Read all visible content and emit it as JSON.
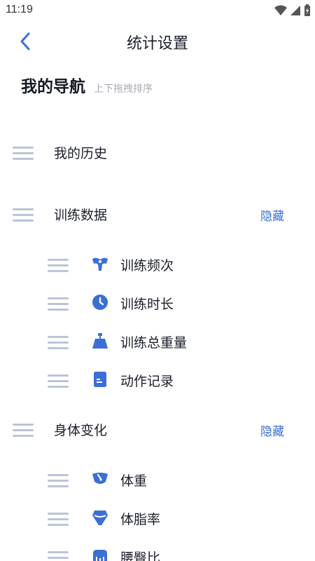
{
  "status_bar": {
    "time": "11:19"
  },
  "header": {
    "title": "统计设置"
  },
  "nav_section": {
    "title": "我的导航",
    "hint": "上下拖拽排序"
  },
  "groups": [
    {
      "label": "我的历史"
    },
    {
      "label": "训练数据",
      "action": "隐藏",
      "items": [
        {
          "label": "训练频次",
          "icon": "muscle-icon"
        },
        {
          "label": "训练时长",
          "icon": "clock-icon"
        },
        {
          "label": "训练总重量",
          "icon": "weight-icon"
        },
        {
          "label": "动作记录",
          "icon": "note-icon"
        }
      ]
    },
    {
      "label": "身体变化",
      "action": "隐藏",
      "items": [
        {
          "label": "体重",
          "icon": "scale-icon"
        },
        {
          "label": "体脂率",
          "icon": "body-fat-icon"
        },
        {
          "label": "腰臀比",
          "icon": "ruler-icon"
        }
      ]
    }
  ],
  "colors": {
    "accent": "#3b6fd6",
    "handle": "#bcc4d8"
  }
}
